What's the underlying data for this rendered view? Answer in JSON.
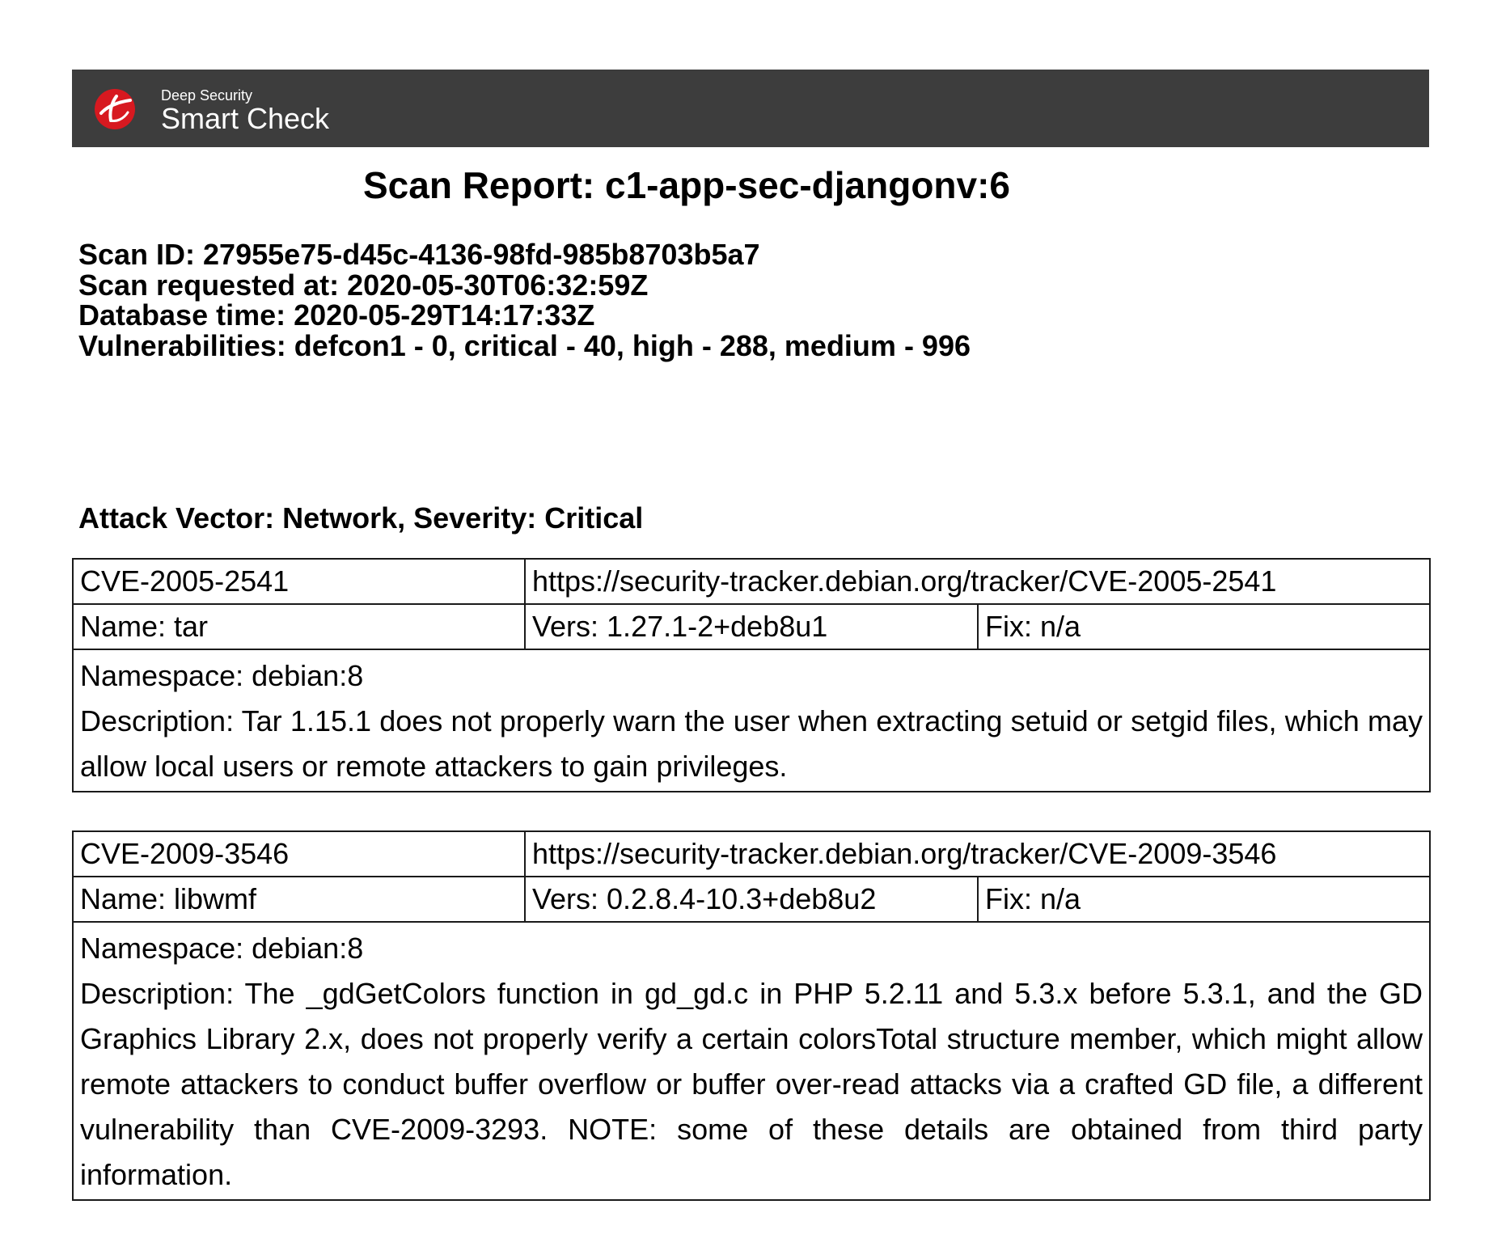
{
  "header": {
    "brand_small": "Deep Security",
    "brand_large": "Smart Check",
    "logo_icon": "trend-micro-logo-icon",
    "bar_color": "#3d3d3d",
    "logo_color": "#d71920"
  },
  "report": {
    "title": "Scan Report: c1-app-sec-djangonv:6",
    "scan_id": "Scan ID: 27955e75-d45c-4136-98fd-985b8703b5a7",
    "scan_requested": "Scan requested at: 2020-05-30T06:32:59Z",
    "database_time": "Database time: 2020-05-29T14:17:33Z",
    "vulnerabilities": "Vulnerabilities: defcon1 - 0, critical - 40, high - 288, medium - 996"
  },
  "section": {
    "heading": "Attack Vector: Network, Severity: Critical"
  },
  "cves": [
    {
      "id": "CVE-2005-2541",
      "url": "https://security-tracker.debian.org/tracker/CVE-2005-2541",
      "name": "Name: tar",
      "version": "Vers: 1.27.1-2+deb8u1",
      "fix": "Fix: n/a",
      "namespace": "Namespace: debian:8",
      "description": "Description: Tar 1.15.1 does not properly warn the user when extracting setuid or setgid files, which may allow local users or remote attackers to gain privileges."
    },
    {
      "id": "CVE-2009-3546",
      "url": "https://security-tracker.debian.org/tracker/CVE-2009-3546",
      "name": "Name: libwmf",
      "version": "Vers: 0.2.8.4-10.3+deb8u2",
      "fix": "Fix: n/a",
      "namespace": "Namespace: debian:8",
      "description": "Description: The _gdGetColors function in gd_gd.c in PHP 5.2.11 and 5.3.x before 5.3.1, and the GD Graphics Library 2.x, does not properly verify a certain colorsTotal structure member, which might allow remote attackers to conduct buffer overflow or buffer over-read attacks via a crafted GD file, a different vulnerability than CVE-2009-3293. NOTE: some of these details are obtained from third party information."
    }
  ]
}
